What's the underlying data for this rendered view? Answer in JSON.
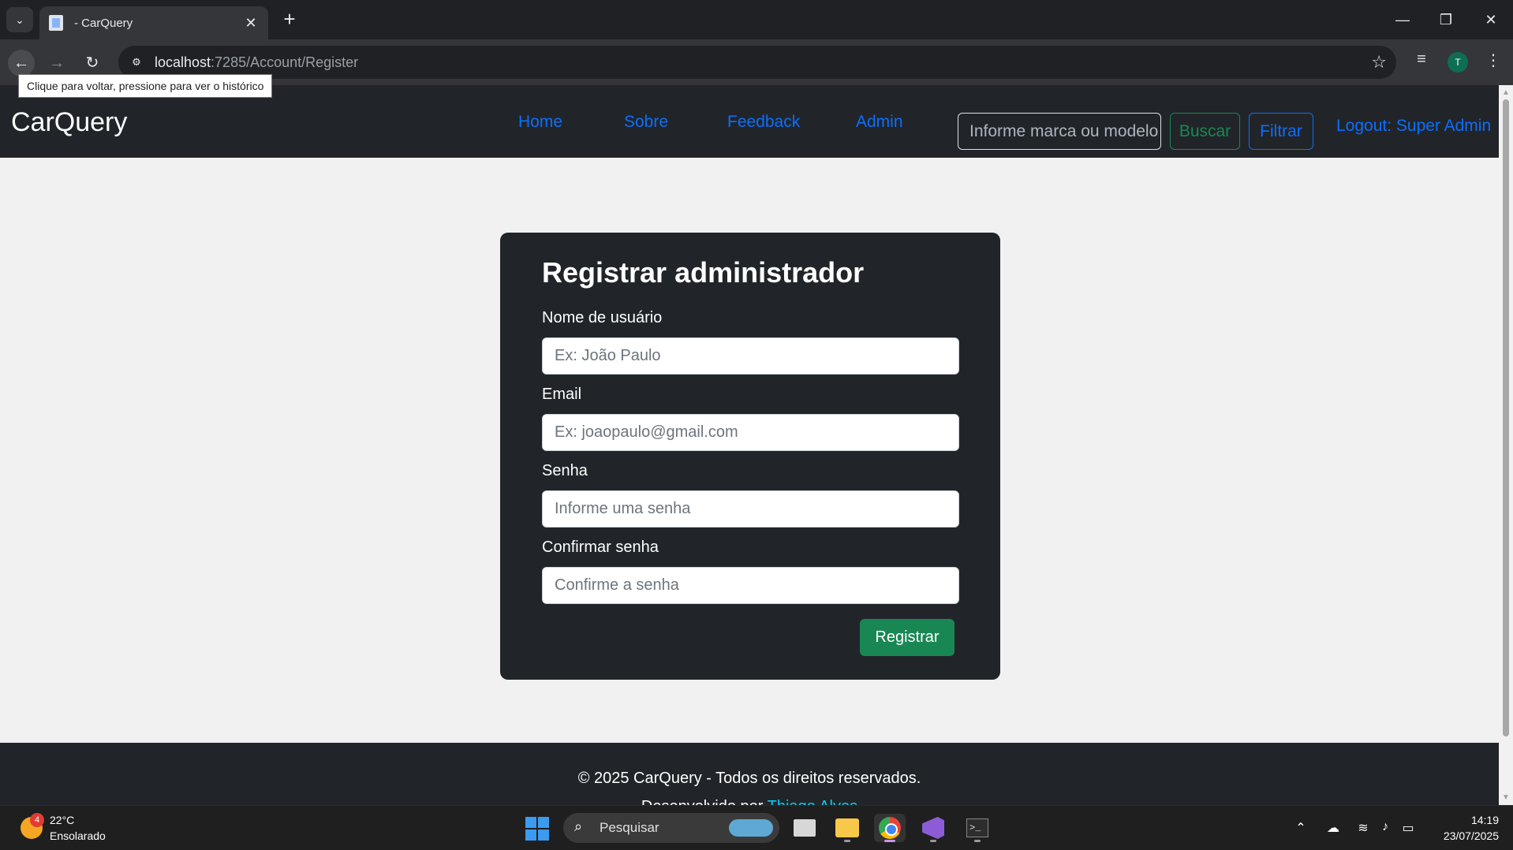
{
  "browser": {
    "tab_title": "- CarQuery",
    "url_host": "localhost",
    "url_rest": ":7285/Account/Register",
    "tooltip": "Clique para voltar, pressione para ver o histórico",
    "profile_initial": "T"
  },
  "navbar": {
    "brand": "CarQuery",
    "links": [
      "Home",
      "Sobre",
      "Feedback",
      "Admin"
    ],
    "search_placeholder": "Informe marca ou modelo",
    "search_button": "Buscar",
    "filter_button": "Filtrar",
    "logout": "Logout: Super Admin"
  },
  "form": {
    "title": "Registrar administrador",
    "fields": [
      {
        "label": "Nome de usuário",
        "placeholder": "Ex: João Paulo"
      },
      {
        "label": "Email",
        "placeholder": "Ex: joaopaulo@gmail.com"
      },
      {
        "label": "Senha",
        "placeholder": "Informe uma senha"
      },
      {
        "label": "Confirmar senha",
        "placeholder": "Confirme a senha"
      }
    ],
    "submit": "Registrar"
  },
  "footer": {
    "copyright": "© 2025 CarQuery - Todos os direitos reservados.",
    "credit_prefix": "Desenvolvido por ",
    "credit_name": "Thiago Alves"
  },
  "taskbar": {
    "weather_badge": "4",
    "temperature": "22°C",
    "weather": "Ensolarado",
    "search_label": "Pesquisar",
    "time": "14:19",
    "date": "23/07/2025"
  },
  "colors": {
    "navbar_bg": "#212529",
    "link_primary": "#0d6efd",
    "success": "#198754",
    "page_bg": "#f1f1f1"
  }
}
